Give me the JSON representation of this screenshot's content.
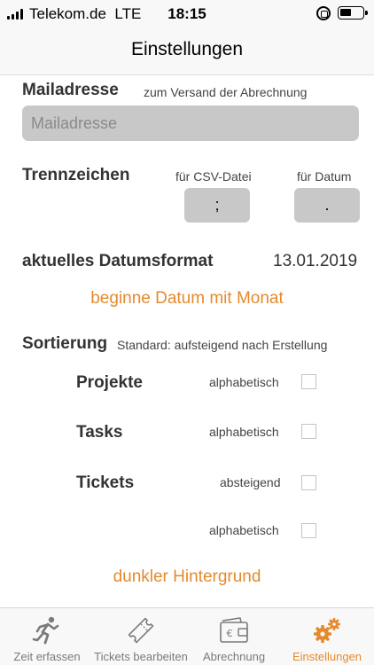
{
  "status_bar": {
    "carrier": "Telekom.de",
    "network": "LTE",
    "time": "18:15"
  },
  "nav": {
    "title": "Einstellungen"
  },
  "mail": {
    "label": "Mailadresse",
    "hint": "zum Versand der Abrechnung",
    "placeholder": "Mailadresse",
    "value": ""
  },
  "separators": {
    "label": "Trennzeichen",
    "csv_label": "für CSV-Datei",
    "csv_value": ";",
    "date_label": "für Datum",
    "date_value": "."
  },
  "date_format": {
    "label": "aktuelles Datumsformat",
    "value": "13.01.2019",
    "action": "beginne Datum mit Monat"
  },
  "sorting": {
    "label": "Sortierung",
    "hint": "Standard: aufsteigend nach Erstellung",
    "rows": [
      {
        "name": "Projekte",
        "option": "alphabetisch",
        "checked": false
      },
      {
        "name": "Tasks",
        "option": "alphabetisch",
        "checked": false
      },
      {
        "name": "Tickets",
        "option": "absteigend",
        "checked": false
      },
      {
        "name": "",
        "option": "alphabetisch",
        "checked": false
      }
    ]
  },
  "dark_mode_label": "dunkler Hintergrund",
  "tabs": [
    {
      "label": "Zeit erfassen",
      "icon": "runner-icon",
      "active": false
    },
    {
      "label": "Tickets bearbeiten",
      "icon": "ticket-icon",
      "active": false
    },
    {
      "label": "Abrechnung",
      "icon": "wallet-euro-icon",
      "active": false
    },
    {
      "label": "Einstellungen",
      "icon": "gears-icon",
      "active": true
    }
  ],
  "colors": {
    "accent": "#e58a2c",
    "input_background": "#c8c8c8",
    "bar_background": "#f8f8f8"
  }
}
